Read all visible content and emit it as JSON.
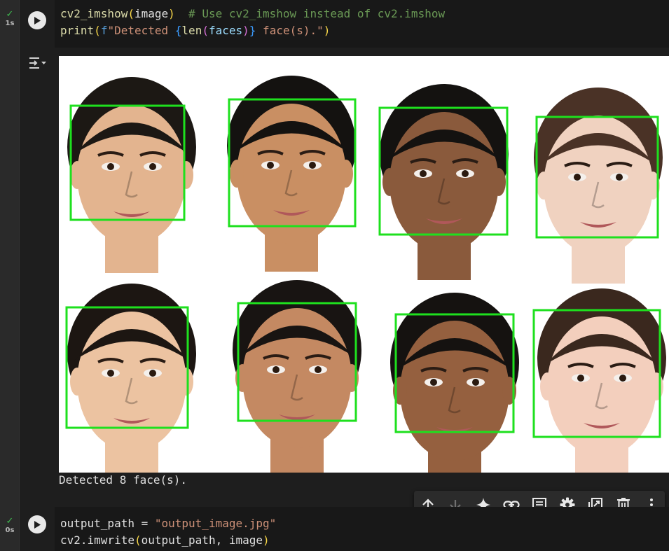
{
  "cells": [
    {
      "status": {
        "check": "✓",
        "time": "1s"
      },
      "code": {
        "line1": {
          "fn": "cv2_imshow",
          "arg": "image",
          "comment": "# Use cv2_imshow instead of cv2.imshow"
        },
        "line2": {
          "fn": "print",
          "fprefix": "f",
          "str_start": "\"Detected ",
          "inner_fn": "len",
          "inner_arg": "faces",
          "str_end": " face(s).\""
        }
      },
      "output": {
        "text": "Detected 8 face(s).",
        "faces_detected": 8,
        "box_color": "#1ee01e",
        "faces": [
          {
            "row": 1,
            "col": 1,
            "skin": "#e3b48f",
            "hair": "#1c1814"
          },
          {
            "row": 1,
            "col": 2,
            "skin": "#c98f63",
            "hair": "#141210"
          },
          {
            "row": 1,
            "col": 3,
            "skin": "#8a5a3c",
            "hair": "#141210"
          },
          {
            "row": 1,
            "col": 4,
            "skin": "#f0d2c0",
            "hair": "#4a3226"
          },
          {
            "row": 2,
            "col": 1,
            "skin": "#ecc3a1",
            "hair": "#1c1612"
          },
          {
            "row": 2,
            "col": 2,
            "skin": "#c48962",
            "hair": "#181412"
          },
          {
            "row": 2,
            "col": 3,
            "skin": "#95603f",
            "hair": "#151210"
          },
          {
            "row": 2,
            "col": 4,
            "skin": "#f3cfbd",
            "hair": "#3a281e"
          }
        ]
      }
    },
    {
      "status": {
        "check": "✓",
        "time": "0s"
      },
      "code": {
        "line1": {
          "var": "output_path",
          "op": " = ",
          "str": "\"output_image.jpg\""
        },
        "line2": {
          "fn": "cv2.imwrite",
          "arg1": "output_path",
          "sep": ", ",
          "arg2": "image"
        }
      }
    }
  ],
  "toolbar": {
    "icons": [
      "arrow-up-icon",
      "arrow-down-icon",
      "gemini-sparkle-icon",
      "link-icon",
      "comment-icon",
      "settings-icon",
      "mirror-cell-icon",
      "delete-icon",
      "more-vert-icon"
    ]
  },
  "colors": {
    "background": "#1e1e1e",
    "gutter": "#2a2a2a",
    "code_bg": "#181818",
    "check": "#3fb950"
  }
}
